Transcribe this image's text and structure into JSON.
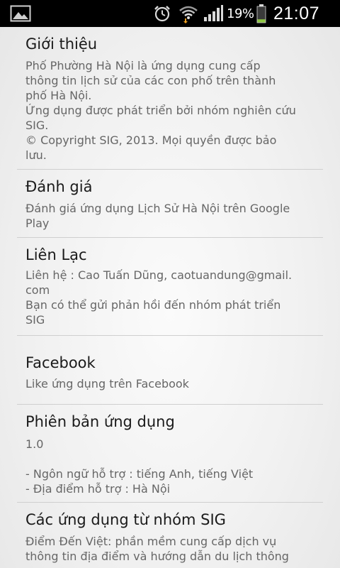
{
  "status_bar": {
    "battery_percent": "19%",
    "time": "21:07",
    "icons": [
      "gallery-icon",
      "alarm-icon",
      "wifi-icon",
      "signal-icon",
      "battery-icon"
    ],
    "battery_fill_level": 0.19,
    "battery_color": "#8cc63f"
  },
  "settings": [
    {
      "title": "Giới thiệu",
      "summary": "Phố Phường Hà Nội là ứng dụng cung cấp\nthông tin lịch sử của các con phố trên thành\nphố Hà Nội.\nỨng dụng được phát triển bởi nhóm nghiên cứu\nSIG.\n© Copyright SIG, 2013. Mọi quyền được bảo\nlưu."
    },
    {
      "title": "Đánh giá",
      "summary": "Đánh giá ứng dụng Lịch Sử Hà Nội trên Google\nPlay"
    },
    {
      "title": "Liên Lạc",
      "summary": "Liên hệ : Cao Tuấn Dũng, caotuandung@gmail.\ncom\nBạn có thể gửi phản hồi đến nhóm phát triển\nSIG"
    },
    {
      "title": "Facebook",
      "summary": "Like ứng dụng trên Facebook"
    },
    {
      "title": "Phiên bản ứng dụng",
      "summary": "1.0\n\n- Ngôn ngữ hỗ trợ : tiếng Anh, tiếng Việt\n- Địa điểm hỗ trợ : Hà Nội"
    },
    {
      "title": "Các ứng dụng từ nhóm SIG",
      "summary": "Điểm Đến Việt: phần mềm cung cấp dịch vụ\nthông tin địa điểm và hướng dẫn du lịch thông"
    }
  ]
}
